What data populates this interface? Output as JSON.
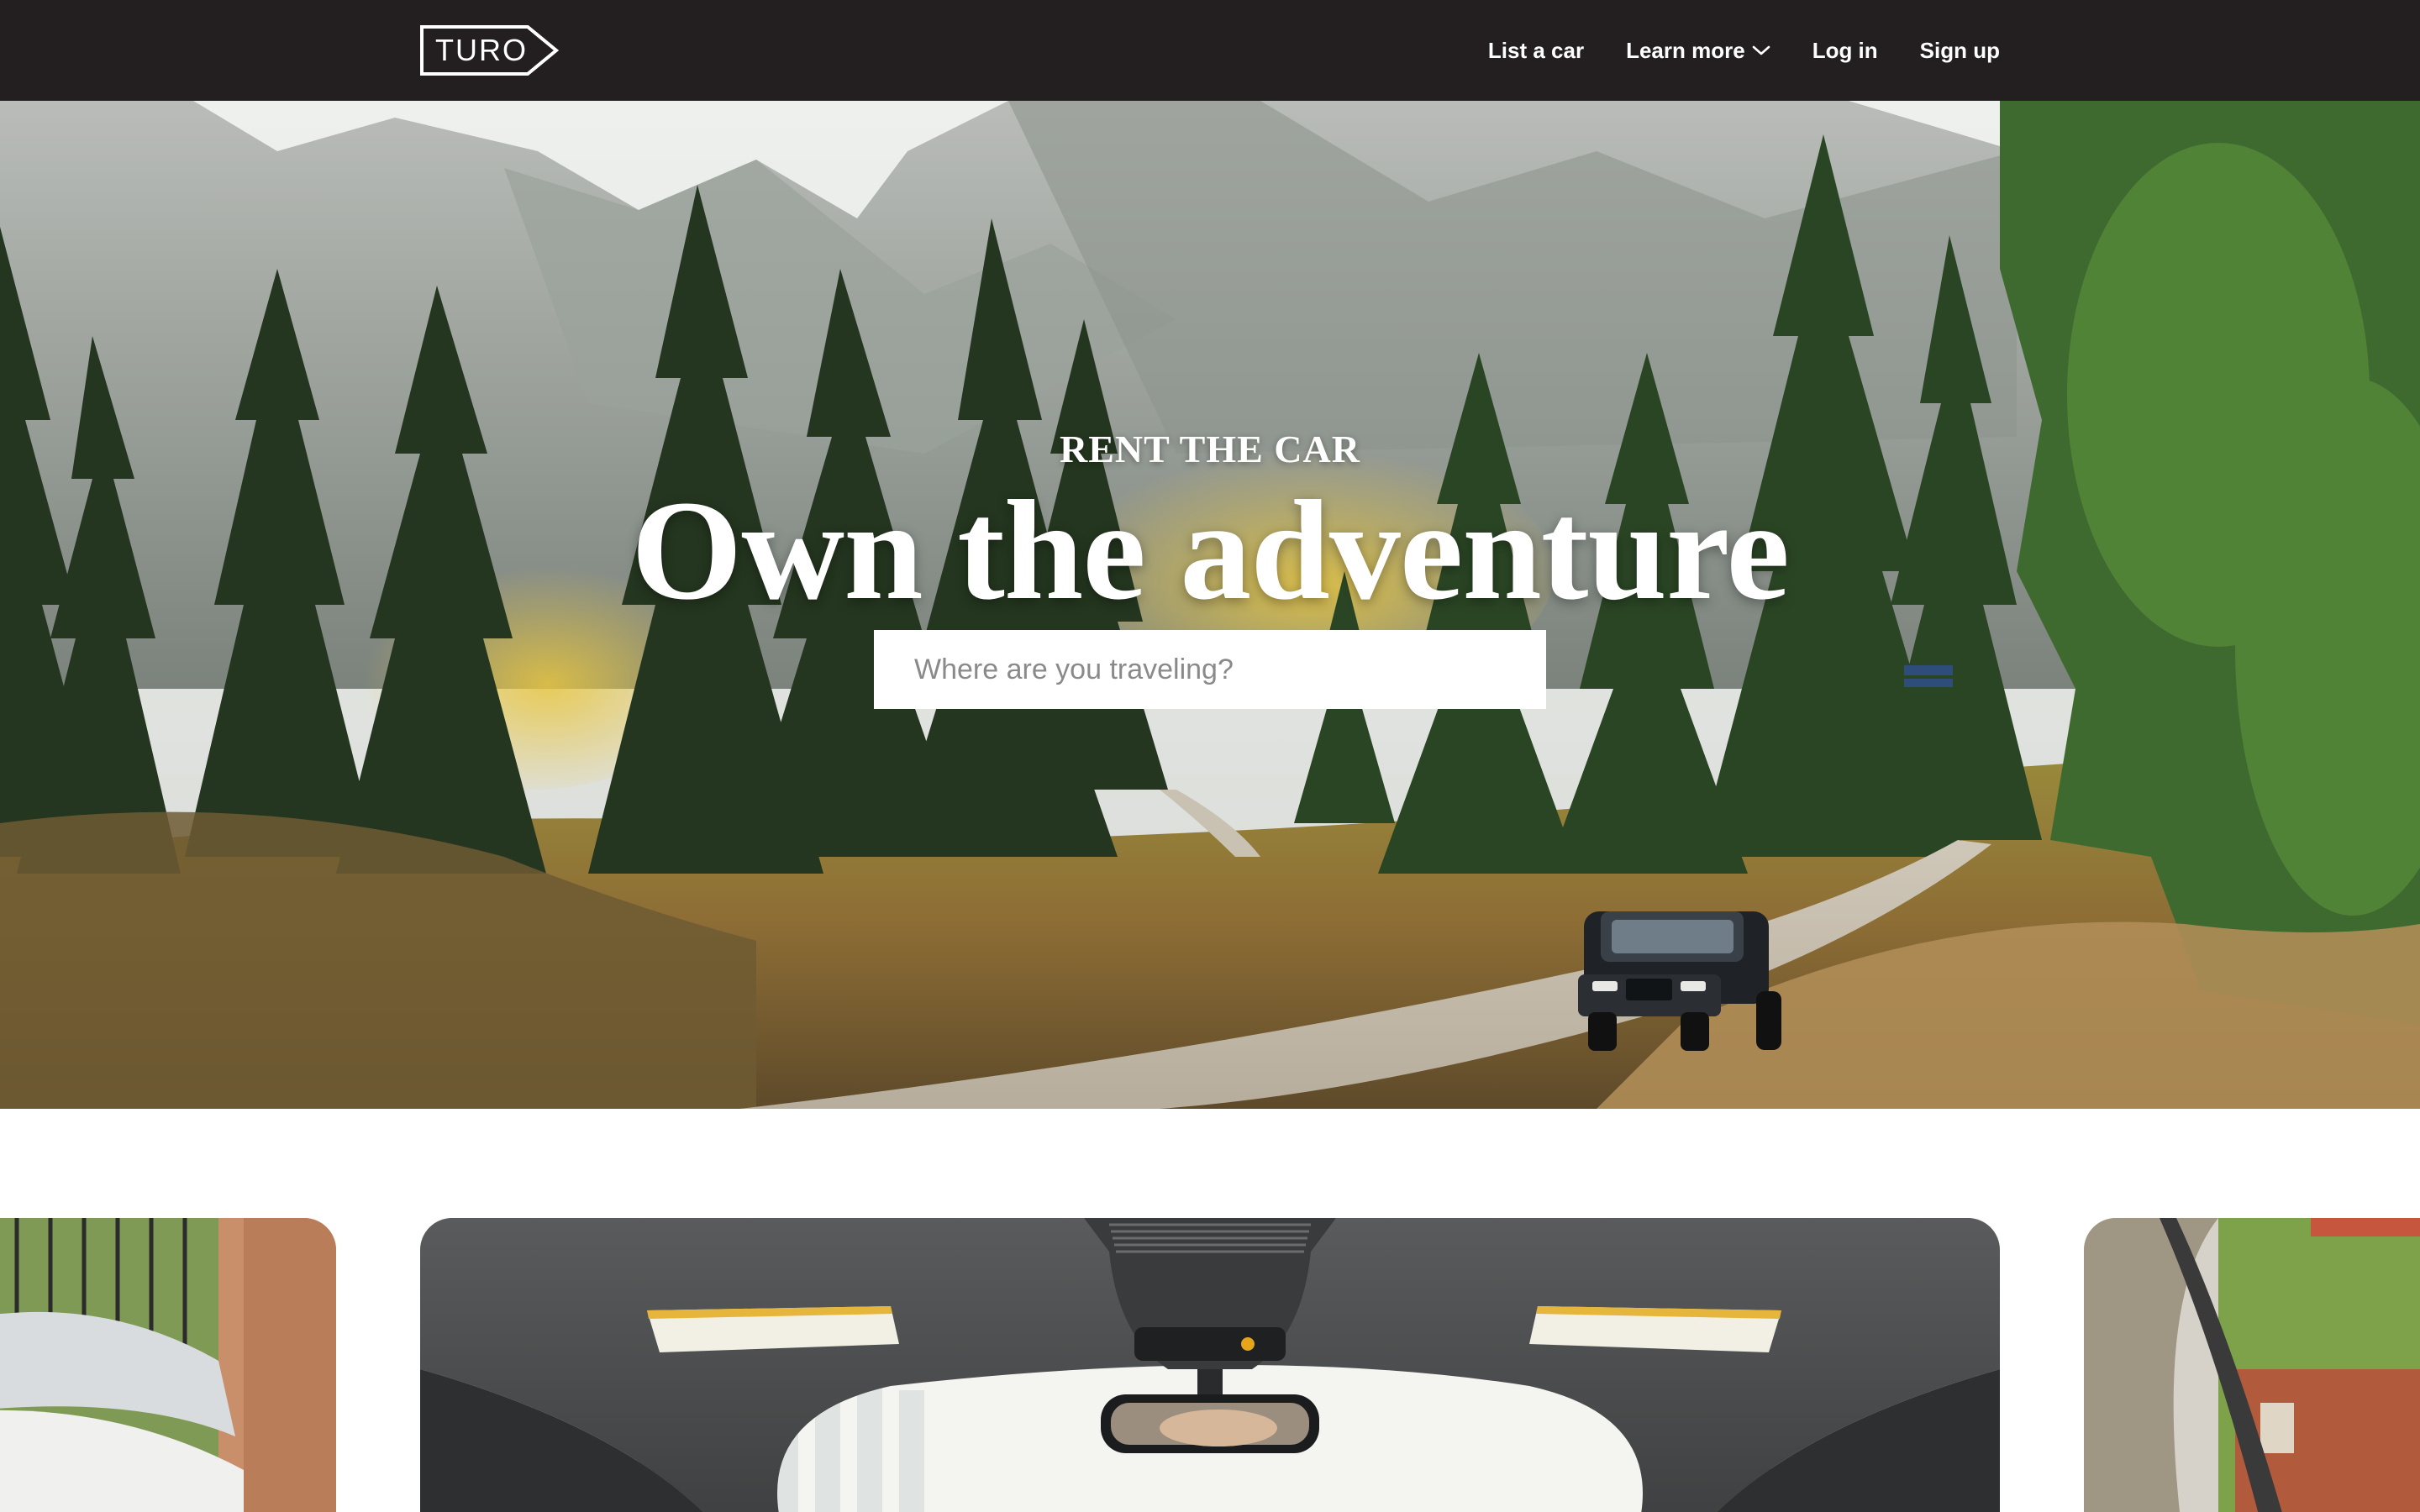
{
  "nav": {
    "logo_text": "TURO",
    "links": [
      {
        "label": "List a car"
      },
      {
        "label": "Learn more",
        "has_dropdown": true
      },
      {
        "label": "Log in"
      },
      {
        "label": "Sign up"
      }
    ]
  },
  "hero": {
    "kicker": "RENT THE CAR",
    "title": "Own the adventure",
    "search_placeholder": "Where are you traveling?"
  },
  "colors": {
    "nav_background": "#231f20",
    "text_on_dark": "#ffffff",
    "page_background": "#ffffff"
  },
  "icons": [
    "turo-logo",
    "chevron-down-icon"
  ]
}
